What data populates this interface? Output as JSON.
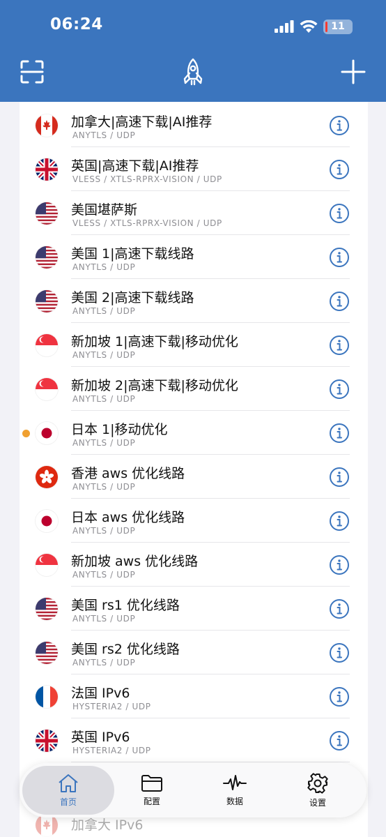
{
  "status_bar": {
    "time": "06:24",
    "battery": "11"
  },
  "toolbar": {
    "left_icon": "scan-icon",
    "center_icon": "rocket-icon",
    "right_icon": "plus-icon"
  },
  "servers": [
    {
      "name": "加拿大|高速下载|AI推荐",
      "protocol": "ANYTLS / UDP",
      "flag": "ca",
      "active": false
    },
    {
      "name": "英国|高速下载|AI推荐",
      "protocol": "VLESS / XTLS-RPRX-VISION / UDP",
      "flag": "gb",
      "active": false
    },
    {
      "name": "美国堪萨斯",
      "protocol": "VLESS / XTLS-RPRX-VISION / UDP",
      "flag": "us",
      "active": false
    },
    {
      "name": "美国 1|高速下载线路",
      "protocol": "ANYTLS / UDP",
      "flag": "us",
      "active": false
    },
    {
      "name": "美国 2|高速下载线路",
      "protocol": "ANYTLS / UDP",
      "flag": "us",
      "active": false
    },
    {
      "name": "新加坡 1|高速下载|移动优化",
      "protocol": "ANYTLS / UDP",
      "flag": "sg",
      "active": false
    },
    {
      "name": "新加坡 2|高速下载|移动优化",
      "protocol": "ANYTLS / UDP",
      "flag": "sg",
      "active": false
    },
    {
      "name": "日本 1|移动优化",
      "protocol": "ANYTLS / UDP",
      "flag": "jp",
      "active": true
    },
    {
      "name": "香港 aws  优化线路",
      "protocol": "ANYTLS / UDP",
      "flag": "hk",
      "active": false
    },
    {
      "name": "日本 aws 优化线路",
      "protocol": "ANYTLS / UDP",
      "flag": "jp",
      "active": false
    },
    {
      "name": "新加坡 aws 优化线路",
      "protocol": "ANYTLS / UDP",
      "flag": "sg",
      "active": false
    },
    {
      "name": "美国 rs1 优化线路",
      "protocol": "ANYTLS / UDP",
      "flag": "us",
      "active": false
    },
    {
      "name": "美国 rs2 优化线路",
      "protocol": "ANYTLS / UDP",
      "flag": "us",
      "active": false
    },
    {
      "name": "法国 IPv6",
      "protocol": "HYSTERIA2 / UDP",
      "flag": "fr",
      "active": false
    },
    {
      "name": "英国 IPv6",
      "protocol": "HYSTERIA2 / UDP",
      "flag": "gb",
      "active": false
    }
  ],
  "partial_row": {
    "name": "加拿大 IPv6",
    "flag": "ca"
  },
  "tabs": [
    {
      "label": "首页",
      "icon": "home-icon",
      "active": true
    },
    {
      "label": "配置",
      "icon": "folder-icon",
      "active": false
    },
    {
      "label": "数据",
      "icon": "activity-icon",
      "active": false
    },
    {
      "label": "设置",
      "icon": "gear-icon",
      "active": false
    }
  ],
  "colors": {
    "header": "#3b75be",
    "accent": "#3b75be",
    "active_dot": "#f0a030"
  }
}
